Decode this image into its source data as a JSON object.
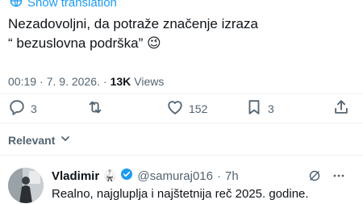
{
  "translation": {
    "label": "Show translation"
  },
  "tweet": {
    "line1": "Nezadovoljni, da potraže značenje izraza",
    "line2": "“ bezuslovna podrška” 😉"
  },
  "meta": {
    "time": "00:19",
    "separator": "·",
    "date": "7. 9. 2026.",
    "views_count": "13K",
    "views_label": "Views"
  },
  "actions": {
    "replies": "3",
    "reposts": "",
    "likes": "152",
    "bookmarks": "3"
  },
  "filter": {
    "label": "Relevant"
  },
  "reply": {
    "name": "Vladimir",
    "badge_emoji": "🥋",
    "handle": "@samuraj016",
    "separator": "·",
    "time": "7h",
    "text": "Realno, najgluplja i najštetnija reč 2025. godine."
  },
  "colors": {
    "accent": "#1d9bf0",
    "muted": "#536471",
    "text": "#0f1419",
    "divider": "#eff3f4"
  },
  "icons": [
    "translate-icon",
    "reply-icon",
    "repost-icon",
    "like-icon",
    "bookmark-icon",
    "share-icon",
    "chevron-down-icon",
    "verified-badge-icon",
    "grok-icon",
    "more-icon"
  ]
}
